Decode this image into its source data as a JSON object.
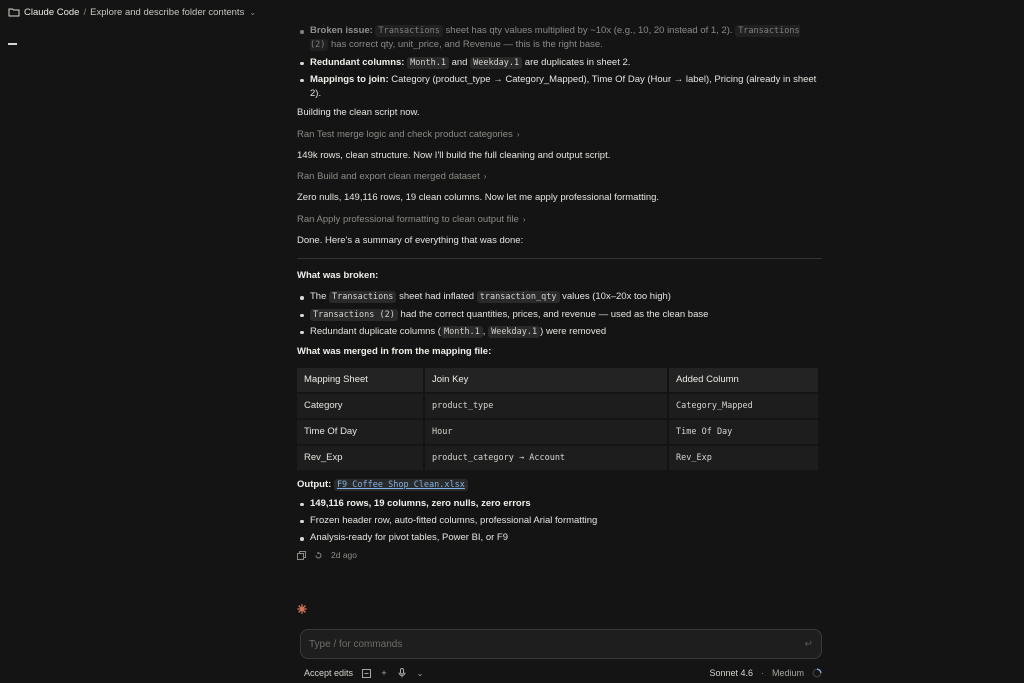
{
  "topbar": {
    "project": "Claude Code",
    "separator": "/",
    "title": "Explore and describe folder contents"
  },
  "transcript": {
    "top_bullets": [
      {
        "label": "Broken issue:",
        "pre": "",
        "code1": "Transactions",
        "mid": " sheet has qty values multiplied by ~10x (e.g., 10, 20 instead of 1, 2). ",
        "code2": "Transactions (2)",
        "post": " has correct qty, unit_price, and Revenue — this is the right base."
      },
      {
        "label": "Redundant columns:",
        "code1": "Month.1",
        "mid": " and ",
        "code2": "Weekday.1",
        "post": " are duplicates in sheet 2."
      },
      {
        "label": "Mappings to join:",
        "text": " Category (product_type → Category_Mapped), Time Of Day (Hour → label), Pricing (already in sheet 2)."
      }
    ],
    "building": "Building the clean script now.",
    "ran1": "Ran Test merge logic and check product categories",
    "msg1": "149k rows, clean structure. Now I'll build the full cleaning and output script.",
    "ran2": "Ran Build and export clean merged dataset",
    "msg2": "Zero nulls, 149,116 rows, 19 clean columns. Now let me apply professional formatting.",
    "ran3": "Ran Apply professional formatting to clean output file",
    "done": "Done. Here's a summary of everything that was done:",
    "broken_heading": "What was broken:",
    "broken_items": [
      {
        "pre": "The ",
        "code": "Transactions",
        "post": " sheet had inflated ",
        "code2": "transaction_qty",
        "post2": " values (10x–20x too high)"
      },
      {
        "code": "Transactions (2)",
        "post": " had the correct quantities, prices, and revenue — used as the clean base"
      },
      {
        "pre": "Redundant duplicate columns (",
        "code": "Month.1",
        "mid": ", ",
        "code2": "Weekday.1",
        "post": ") were removed"
      }
    ],
    "merged_heading": "What was merged in from the mapping file:",
    "table": {
      "headers": [
        "Mapping Sheet",
        "Join Key",
        "Added Column"
      ],
      "rows": [
        [
          "Category",
          "product_type",
          "Category_Mapped"
        ],
        [
          "Time Of Day",
          "Hour",
          "Time Of Day"
        ],
        [
          "Rev_Exp",
          "product_category → Account",
          "Rev_Exp"
        ]
      ]
    },
    "output_label": "Output:",
    "output_file": "F9_Coffee_Shop_Clean.xlsx",
    "output_items": [
      {
        "text": "149,116 rows, 19 columns, zero nulls, zero errors",
        "bold": true
      },
      {
        "text": "Frozen header row, auto-fitted columns, professional Arial formatting",
        "bold": false
      },
      {
        "text": "Analysis-ready for pivot tables, Power BI, or F9",
        "bold": false
      }
    ],
    "timestamp": "2d ago"
  },
  "composer": {
    "placeholder": "Type / for commands",
    "accept_edits": "Accept edits",
    "model": "Sonnet 4.6",
    "dot": "·",
    "effort": "Medium"
  },
  "colors": {
    "background": "#141414",
    "accent_spark": "#d97757",
    "link": "#7fb3e6"
  }
}
